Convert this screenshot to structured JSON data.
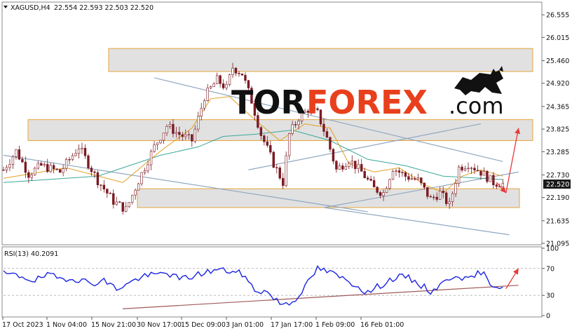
{
  "chart_header": {
    "symbol": "XAGUSD,H4",
    "ohlc": "22.554 22.593 22.503 22.520"
  },
  "watermark": {
    "tor": "TOR",
    "forex": "FOREX",
    "com": ".com",
    "colors": {
      "tor": "#111111",
      "forex": "#e8401c",
      "com": "#111111"
    }
  },
  "chart_data": [
    {
      "type": "candlestick",
      "symbol": "XAGUSD",
      "timeframe": "H4",
      "ylim": [
        21.095,
        26.825
      ],
      "y_ticks": [
        "26.555",
        "26.015",
        "25.460",
        "24.920",
        "24.365",
        "23.825",
        "23.285",
        "22.730",
        "22.190",
        "21.635",
        "21.095"
      ],
      "last_price": "22.520",
      "path": [
        [
          0,
          22.85
        ],
        [
          4,
          23.3
        ],
        [
          8,
          22.75
        ],
        [
          12,
          22.95
        ],
        [
          18,
          22.8
        ],
        [
          24,
          23.4
        ],
        [
          30,
          22.6
        ],
        [
          35,
          22.1
        ],
        [
          39,
          21.9
        ],
        [
          43,
          22.6
        ],
        [
          48,
          23.4
        ],
        [
          52,
          23.9
        ],
        [
          56,
          23.7
        ],
        [
          60,
          23.55
        ],
        [
          64,
          24.6
        ],
        [
          68,
          25.0
        ],
        [
          71,
          24.8
        ],
        [
          73,
          25.3
        ],
        [
          76,
          25.15
        ],
        [
          79,
          24.5
        ],
        [
          82,
          23.7
        ],
        [
          86,
          23.0
        ],
        [
          89,
          22.55
        ],
        [
          91,
          23.7
        ],
        [
          94,
          24.1
        ],
        [
          97,
          24.3
        ],
        [
          100,
          24.2
        ],
        [
          103,
          23.6
        ],
        [
          106,
          22.85
        ],
        [
          110,
          23.1
        ],
        [
          114,
          22.8
        ],
        [
          118,
          22.4
        ],
        [
          121,
          22.3
        ],
        [
          124,
          22.9
        ],
        [
          128,
          22.7
        ],
        [
          132,
          22.6
        ],
        [
          136,
          22.15
        ],
        [
          139,
          22.3
        ],
        [
          142,
          22.0
        ],
        [
          145,
          22.9
        ],
        [
          148,
          23.0
        ],
        [
          152,
          22.8
        ],
        [
          156,
          22.55
        ],
        [
          159,
          22.52
        ]
      ],
      "ma_slow": [
        [
          0,
          22.55
        ],
        [
          30,
          22.7
        ],
        [
          50,
          23.2
        ],
        [
          62,
          23.4
        ],
        [
          70,
          23.65
        ],
        [
          80,
          23.7
        ],
        [
          92,
          23.8
        ],
        [
          104,
          23.55
        ],
        [
          116,
          23.1
        ],
        [
          128,
          22.95
        ],
        [
          140,
          22.7
        ],
        [
          152,
          22.65
        ],
        [
          159,
          22.62
        ]
      ],
      "ma_fast": [
        [
          0,
          22.65
        ],
        [
          20,
          22.9
        ],
        [
          38,
          22.55
        ],
        [
          50,
          23.3
        ],
        [
          60,
          23.85
        ],
        [
          66,
          24.55
        ],
        [
          72,
          24.6
        ],
        [
          80,
          24.05
        ],
        [
          88,
          23.55
        ],
        [
          96,
          23.95
        ],
        [
          104,
          23.85
        ],
        [
          110,
          23.0
        ],
        [
          118,
          22.8
        ],
        [
          126,
          22.9
        ],
        [
          134,
          22.5
        ],
        [
          140,
          22.3
        ],
        [
          146,
          22.7
        ],
        [
          152,
          22.85
        ],
        [
          159,
          22.7
        ]
      ],
      "zones": [
        {
          "from": 25.2,
          "to": 25.75
        },
        {
          "from": 23.55,
          "to": 24.05
        },
        {
          "from": 21.95,
          "to": 22.4
        }
      ],
      "channel_lines": [
        {
          "from": [
            48,
            25.05
          ],
          "to": [
            159,
            23.05
          ]
        },
        {
          "from": [
            0,
            23.2
          ],
          "to": [
            116,
            21.85
          ]
        },
        {
          "from": [
            78,
            22.85
          ],
          "to": [
            152,
            23.95
          ]
        },
        {
          "from": [
            102,
            21.95
          ],
          "to": [
            164,
            22.8
          ]
        },
        {
          "from": [
            102,
            21.95
          ],
          "to": [
            161,
            21.3
          ]
        }
      ],
      "forecast_arrows": [
        {
          "from": [
            157,
            22.55
          ],
          "to": [
            160,
            22.3
          ]
        },
        {
          "from": [
            160,
            22.3
          ],
          "to": [
            164,
            23.85
          ]
        }
      ]
    },
    {
      "type": "line",
      "name": "RSI(13)",
      "value_label": "40.2091",
      "ylim": [
        0,
        100
      ],
      "y_ticks": [
        "100",
        "70",
        "30",
        "0"
      ],
      "levels": [
        70,
        30
      ],
      "path": [
        [
          0,
          62
        ],
        [
          6,
          58
        ],
        [
          10,
          52
        ],
        [
          14,
          60
        ],
        [
          18,
          55
        ],
        [
          22,
          56
        ],
        [
          28,
          48
        ],
        [
          32,
          52
        ],
        [
          36,
          40
        ],
        [
          40,
          48
        ],
        [
          44,
          58
        ],
        [
          48,
          60
        ],
        [
          52,
          64
        ],
        [
          56,
          54
        ],
        [
          60,
          58
        ],
        [
          64,
          64
        ],
        [
          68,
          68
        ],
        [
          72,
          66
        ],
        [
          76,
          62
        ],
        [
          80,
          38
        ],
        [
          84,
          35
        ],
        [
          88,
          18
        ],
        [
          92,
          20
        ],
        [
          96,
          42
        ],
        [
          100,
          70
        ],
        [
          104,
          64
        ],
        [
          108,
          55
        ],
        [
          112,
          46
        ],
        [
          116,
          34
        ],
        [
          120,
          45
        ],
        [
          124,
          55
        ],
        [
          128,
          58
        ],
        [
          132,
          48
        ],
        [
          136,
          36
        ],
        [
          140,
          48
        ],
        [
          144,
          62
        ],
        [
          148,
          52
        ],
        [
          152,
          65
        ],
        [
          156,
          45
        ],
        [
          160,
          42
        ],
        [
          164,
          40
        ]
      ],
      "trendline": {
        "from": [
          0,
          10
        ],
        "to": [
          164,
          45
        ]
      },
      "forecast_arrow": {
        "from": [
          160,
          40
        ],
        "to": [
          164,
          70
        ]
      }
    }
  ],
  "x_labels": [
    "17 Oct 2023",
    "1 Nov 04:00",
    "15 Nov 21:00",
    "30 Nov 17:00",
    "15 Dec 09:00",
    "3 Jan 01:00",
    "17 Jan 17:00",
    "1 Feb 09:00",
    "16 Feb 01:00"
  ],
  "colors": {
    "bull": "#7a1a22",
    "bear": "#7a1a22",
    "ma_slow": "#3aa89a",
    "ma_fast": "#e0a020",
    "zone_fill": "#dcdcdc",
    "zone_border": "#e6a43a",
    "channel": "#90a8c0",
    "arrow": "#e63a3a",
    "rsi_line": "#1a24e0",
    "rsi_trend": "#a05a5a",
    "price_tag_bg": "#1a1a1a"
  }
}
